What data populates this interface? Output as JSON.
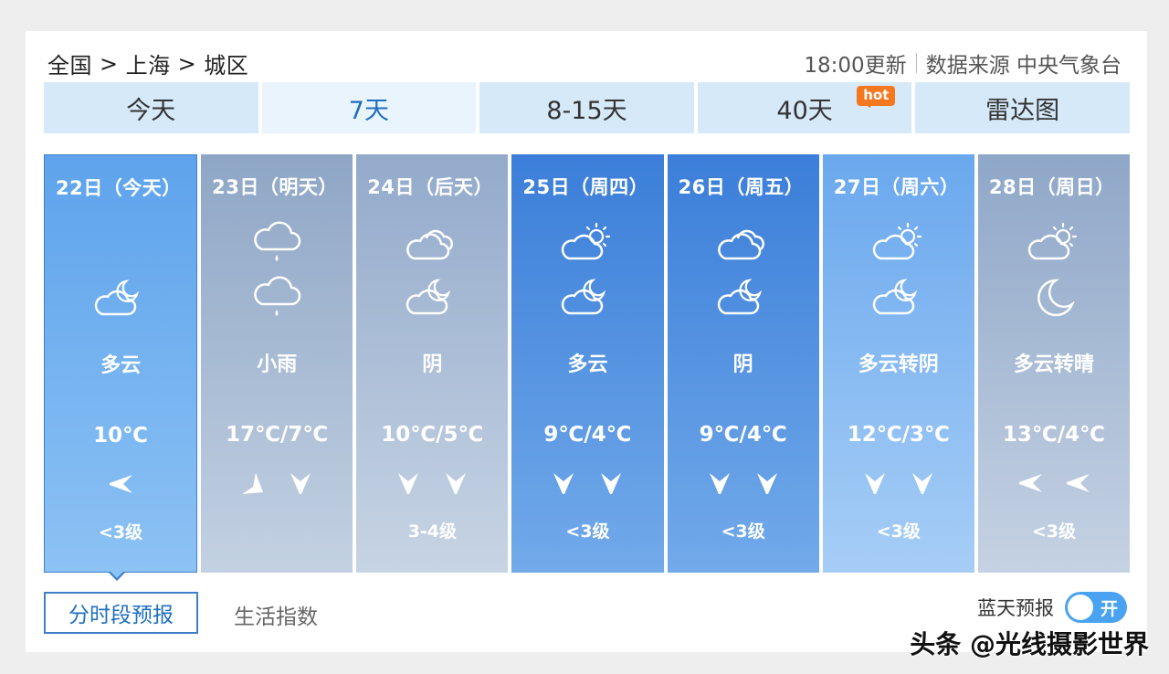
{
  "breadcrumb": {
    "country": "全国",
    "city": "上海",
    "district": "城区",
    "separator": ">"
  },
  "header": {
    "update_time": "18:00更新",
    "source": "数据来源 中央气象台"
  },
  "tabs": [
    {
      "label": "今天"
    },
    {
      "label": "7天"
    },
    {
      "label": "8-15天"
    },
    {
      "label": "40天",
      "badge": "hot"
    },
    {
      "label": "雷达图"
    }
  ],
  "days": [
    {
      "date": "22日（今天）",
      "icon_day": "",
      "icon_night": "cloud-moon-icon",
      "condition": "多云",
      "temp": "10℃",
      "wind_dirs": [
        "west-wind-icon"
      ],
      "wind_level": "<3级"
    },
    {
      "date": "23日（明天）",
      "icon_day": "rain-icon",
      "icon_night": "rain-icon",
      "condition": "小雨",
      "temp": "17℃/7℃",
      "wind_dirs": [
        "northeast-wind-icon",
        "north-wind-icon"
      ],
      "wind_level": ""
    },
    {
      "date": "24日（后天）",
      "icon_day": "overcast-icon",
      "icon_night": "cloud-moon-icon",
      "condition": "阴",
      "temp": "10℃/5℃",
      "wind_dirs": [
        "north-wind-icon",
        "north-wind-icon"
      ],
      "wind_level": "3-4级"
    },
    {
      "date": "25日（周四）",
      "icon_day": "cloud-sun-icon",
      "icon_night": "cloud-moon-icon",
      "condition": "多云",
      "temp": "9℃/4℃",
      "wind_dirs": [
        "north-wind-icon",
        "north-wind-icon"
      ],
      "wind_level": "<3级"
    },
    {
      "date": "26日（周五）",
      "icon_day": "overcast-icon",
      "icon_night": "cloud-moon-icon",
      "condition": "阴",
      "temp": "9℃/4℃",
      "wind_dirs": [
        "north-wind-icon",
        "north-wind-icon"
      ],
      "wind_level": "<3级"
    },
    {
      "date": "27日（周六）",
      "icon_day": "cloud-sun-icon",
      "icon_night": "cloud-moon-icon",
      "condition": "多云转阴",
      "temp": "12℃/3℃",
      "wind_dirs": [
        "north-wind-icon",
        "north-wind-icon"
      ],
      "wind_level": "<3级"
    },
    {
      "date": "28日（周日）",
      "icon_day": "cloud-sun-icon",
      "icon_night": "moon-icon",
      "condition": "多云转晴",
      "temp": "13℃/4℃",
      "wind_dirs": [
        "west-wind-icon",
        "west-wind-icon"
      ],
      "wind_level": "<3级"
    }
  ],
  "subtabs": {
    "hourly": "分时段预报",
    "life_index": "生活指数"
  },
  "bluesky": {
    "label": "蓝天预报",
    "toggle_state": "开"
  },
  "watermark": "头条 @光线摄影世界",
  "colors": {
    "accent": "#1e6fbf",
    "tab_bg": "#d6e9f9",
    "hot_badge": "#f5781f",
    "toggle": "#4aa3f0"
  }
}
